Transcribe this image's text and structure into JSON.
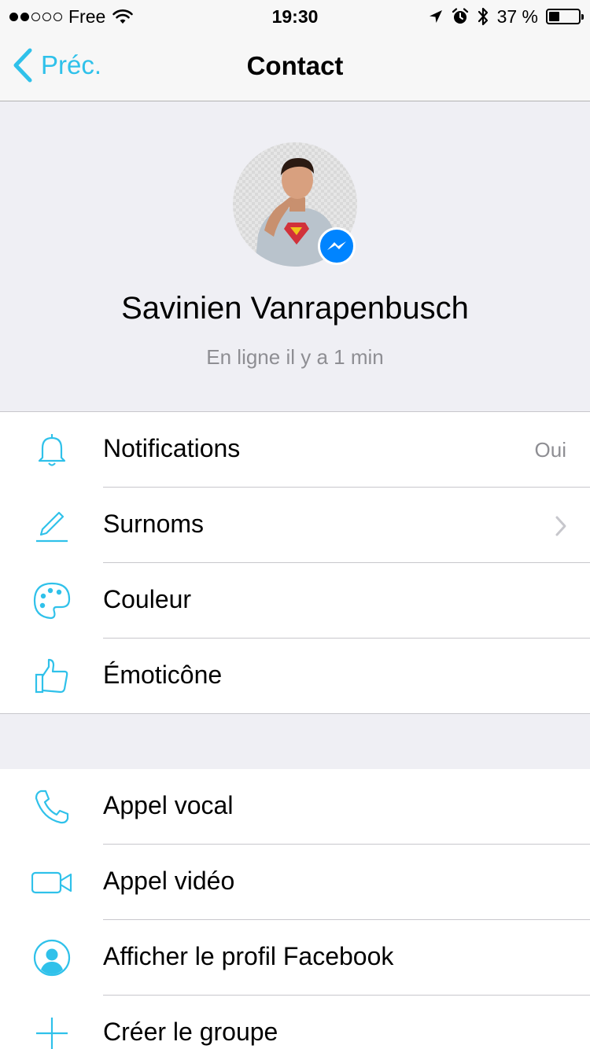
{
  "status_bar": {
    "carrier": "Free",
    "time": "19:30",
    "battery_percent": "37 %",
    "battery_level": 0.37,
    "signal_bars_filled": 2,
    "signal_bars_total": 5
  },
  "nav": {
    "back_label": "Préc.",
    "title": "Contact"
  },
  "profile": {
    "name": "Savinien Vanrapenbusch",
    "status": "En ligne il y a 1 min"
  },
  "settings": [
    {
      "key": "notifications",
      "label": "Notifications",
      "value": "Oui",
      "icon": "bell-icon"
    },
    {
      "key": "nicknames",
      "label": "Surnoms",
      "icon": "pencil-icon"
    },
    {
      "key": "color",
      "label": "Couleur",
      "icon": "palette-icon"
    },
    {
      "key": "emoji",
      "label": "Émoticône",
      "icon": "thumbs-up-icon"
    }
  ],
  "actions": [
    {
      "key": "voice-call",
      "label": "Appel vocal",
      "icon": "phone-icon"
    },
    {
      "key": "video-call",
      "label": "Appel vidéo",
      "icon": "video-camera-icon"
    },
    {
      "key": "facebook-profile",
      "label": "Afficher le profil Facebook",
      "icon": "profile-icon"
    },
    {
      "key": "create-group",
      "label": "Créer le groupe",
      "icon": "plus-icon"
    }
  ],
  "colors": {
    "accent": "#2fc1ea",
    "messenger_blue": "#0084ff",
    "secondary_text": "#8e8e93",
    "grouped_background": "#efeff4"
  }
}
